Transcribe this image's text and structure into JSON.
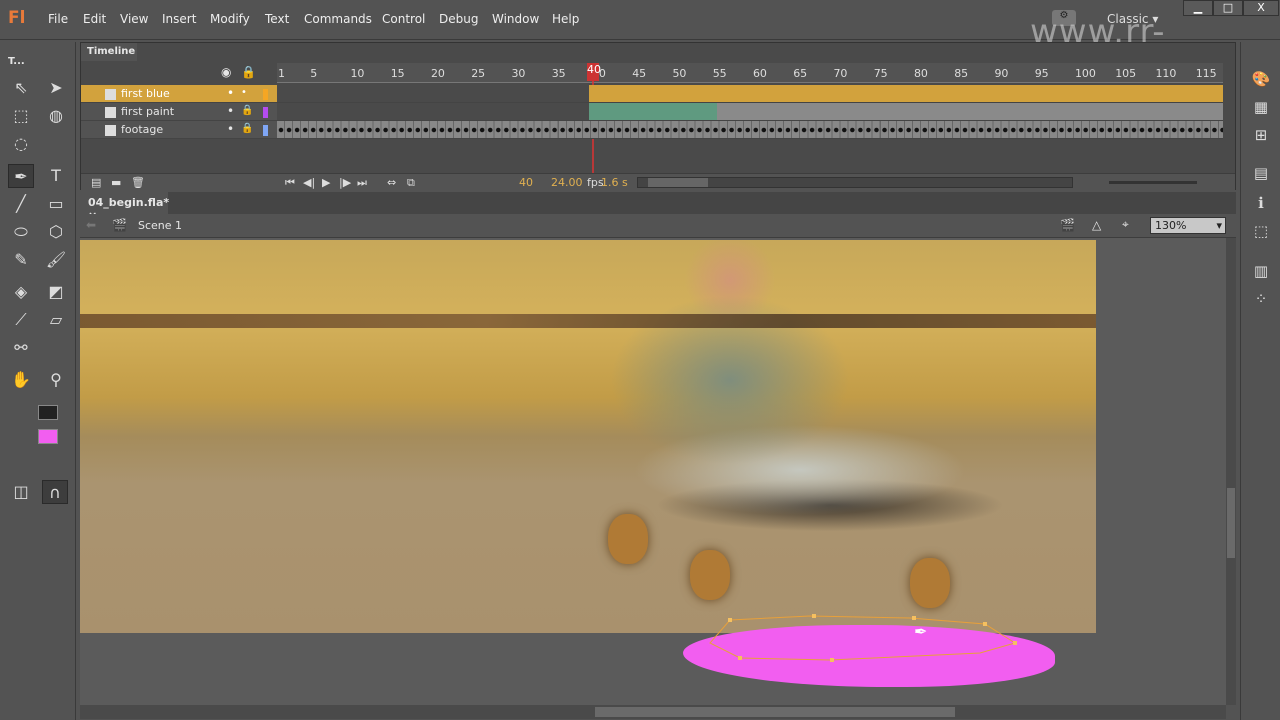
{
  "app": {
    "logo": "Fl",
    "workspace": "Classic",
    "watermark": "www.rr-sc.com"
  },
  "menu": [
    "File",
    "Edit",
    "View",
    "Insert",
    "Modify",
    "Text",
    "Commands",
    "Control",
    "Debug",
    "Window",
    "Help"
  ],
  "window_controls": {
    "minimize": "▁",
    "maximize": "□",
    "close": "X"
  },
  "tools_panel": {
    "title": "T..."
  },
  "timeline": {
    "tab": "Timeline",
    "ruler": [
      "1",
      "5",
      "10",
      "15",
      "20",
      "25",
      "30",
      "35",
      "40",
      "45",
      "50",
      "55",
      "60",
      "65",
      "70",
      "75",
      "80",
      "85",
      "90",
      "95",
      "100",
      "105",
      "110",
      "115"
    ],
    "layers": [
      {
        "name": "first blue",
        "color": "#f5a623",
        "selected": true
      },
      {
        "name": "first paint",
        "color": "#b44cf0",
        "selected": false
      },
      {
        "name": "footage",
        "color": "#7fa6f5",
        "selected": false
      }
    ],
    "current_frame": "40",
    "fps": "24.00",
    "fps_unit": "fps",
    "time": "1.6 s"
  },
  "document": {
    "tab": "04_begin.fla*",
    "close": "×",
    "scene": "Scene 1",
    "zoom": "130%"
  },
  "colors": {
    "stroke": "#222222",
    "fill": "#f25ef0",
    "selected_layer": "#d2a23d",
    "tween": "#5f9a80"
  }
}
